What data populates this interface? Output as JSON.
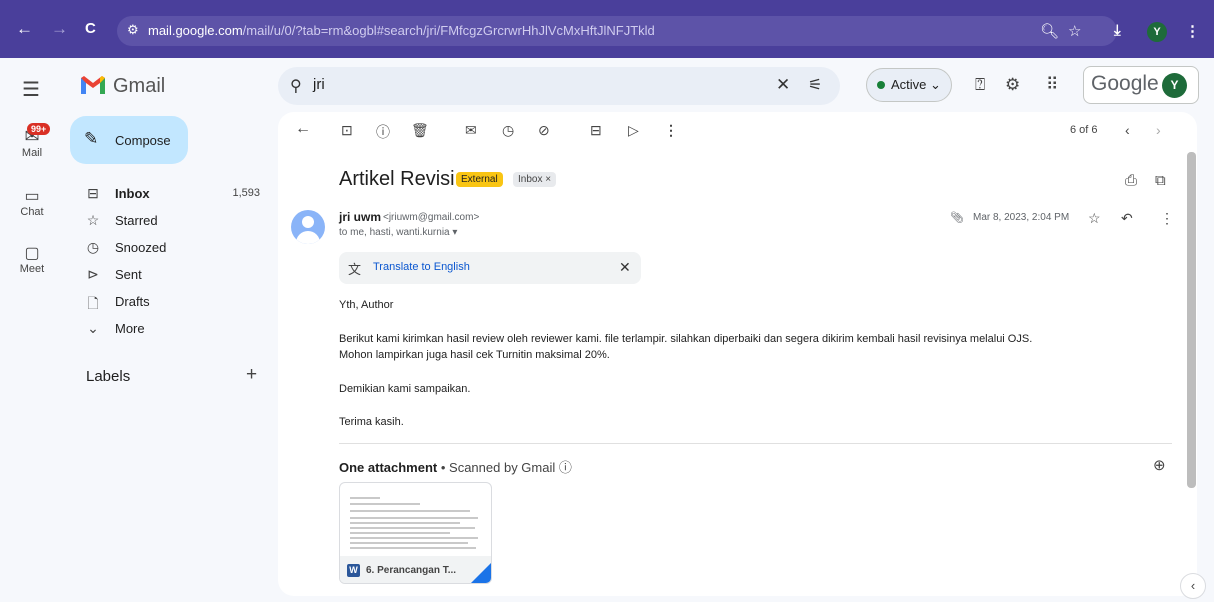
{
  "browser": {
    "back": "←",
    "forward": "→",
    "reload": "C",
    "site_icon": "⚙",
    "url_domain": "mail.google.com",
    "url_path": "/mail/u/0/?tab=rm&ogbl#search/jri/FMfcgzGrcrwrHhJlVcMxHftJlNFJTkld",
    "zoom_icon": "zoom-icon",
    "profile_letter": "Y"
  },
  "header": {
    "app_name": "Gmail",
    "search_query": "jri",
    "status": "Active",
    "status_color": "#188038",
    "google_word": "Google",
    "avatar_letter": "Y"
  },
  "rail": {
    "mail_badge": "99+",
    "mail": "Mail",
    "chat": "Chat",
    "meet": "Meet"
  },
  "sidebar": {
    "compose": "Compose",
    "items": [
      {
        "label": "Inbox",
        "count": "1,593",
        "icon": "inbox-icon"
      },
      {
        "label": "Starred",
        "count": "",
        "icon": "star-icon"
      },
      {
        "label": "Snoozed",
        "count": "",
        "icon": "clock-icon"
      },
      {
        "label": "Sent",
        "count": "",
        "icon": "send-icon"
      },
      {
        "label": "Drafts",
        "count": "",
        "icon": "draft-icon"
      },
      {
        "label": "More",
        "count": "",
        "icon": "chevron-down-icon"
      }
    ],
    "labels_title": "Labels"
  },
  "toolbar": {
    "pager": "6 of 6"
  },
  "email": {
    "subject": "Artikel Revisi",
    "tag_external": "External",
    "tag_inbox": "Inbox ×",
    "sender_name": "jri uwm",
    "sender_email": "<jriuwm@gmail.com>",
    "recipients": "to me, hasti, wanti.kurnia ▾",
    "date": "Mar 8, 2023, 2:04 PM",
    "translate": "Translate to English",
    "body": {
      "greeting": "Yth, Author",
      "line1": "Berikut kami kirimkan hasil review oleh reviewer kami. file terlampir. silahkan diperbaiki dan segera dikirim kembali hasil revisinya melalui OJS.",
      "line2": "Mohon lampirkan juga hasil cek Turnitin maksimal 20%.",
      "closing1": "Demikian kami sampaikan.",
      "closing2": "Terima kasih."
    },
    "attachment_title": "One attachment",
    "attachment_scanned": " • Scanned by Gmail ⓘ",
    "attachment_name": "6. Perancangan T..."
  }
}
